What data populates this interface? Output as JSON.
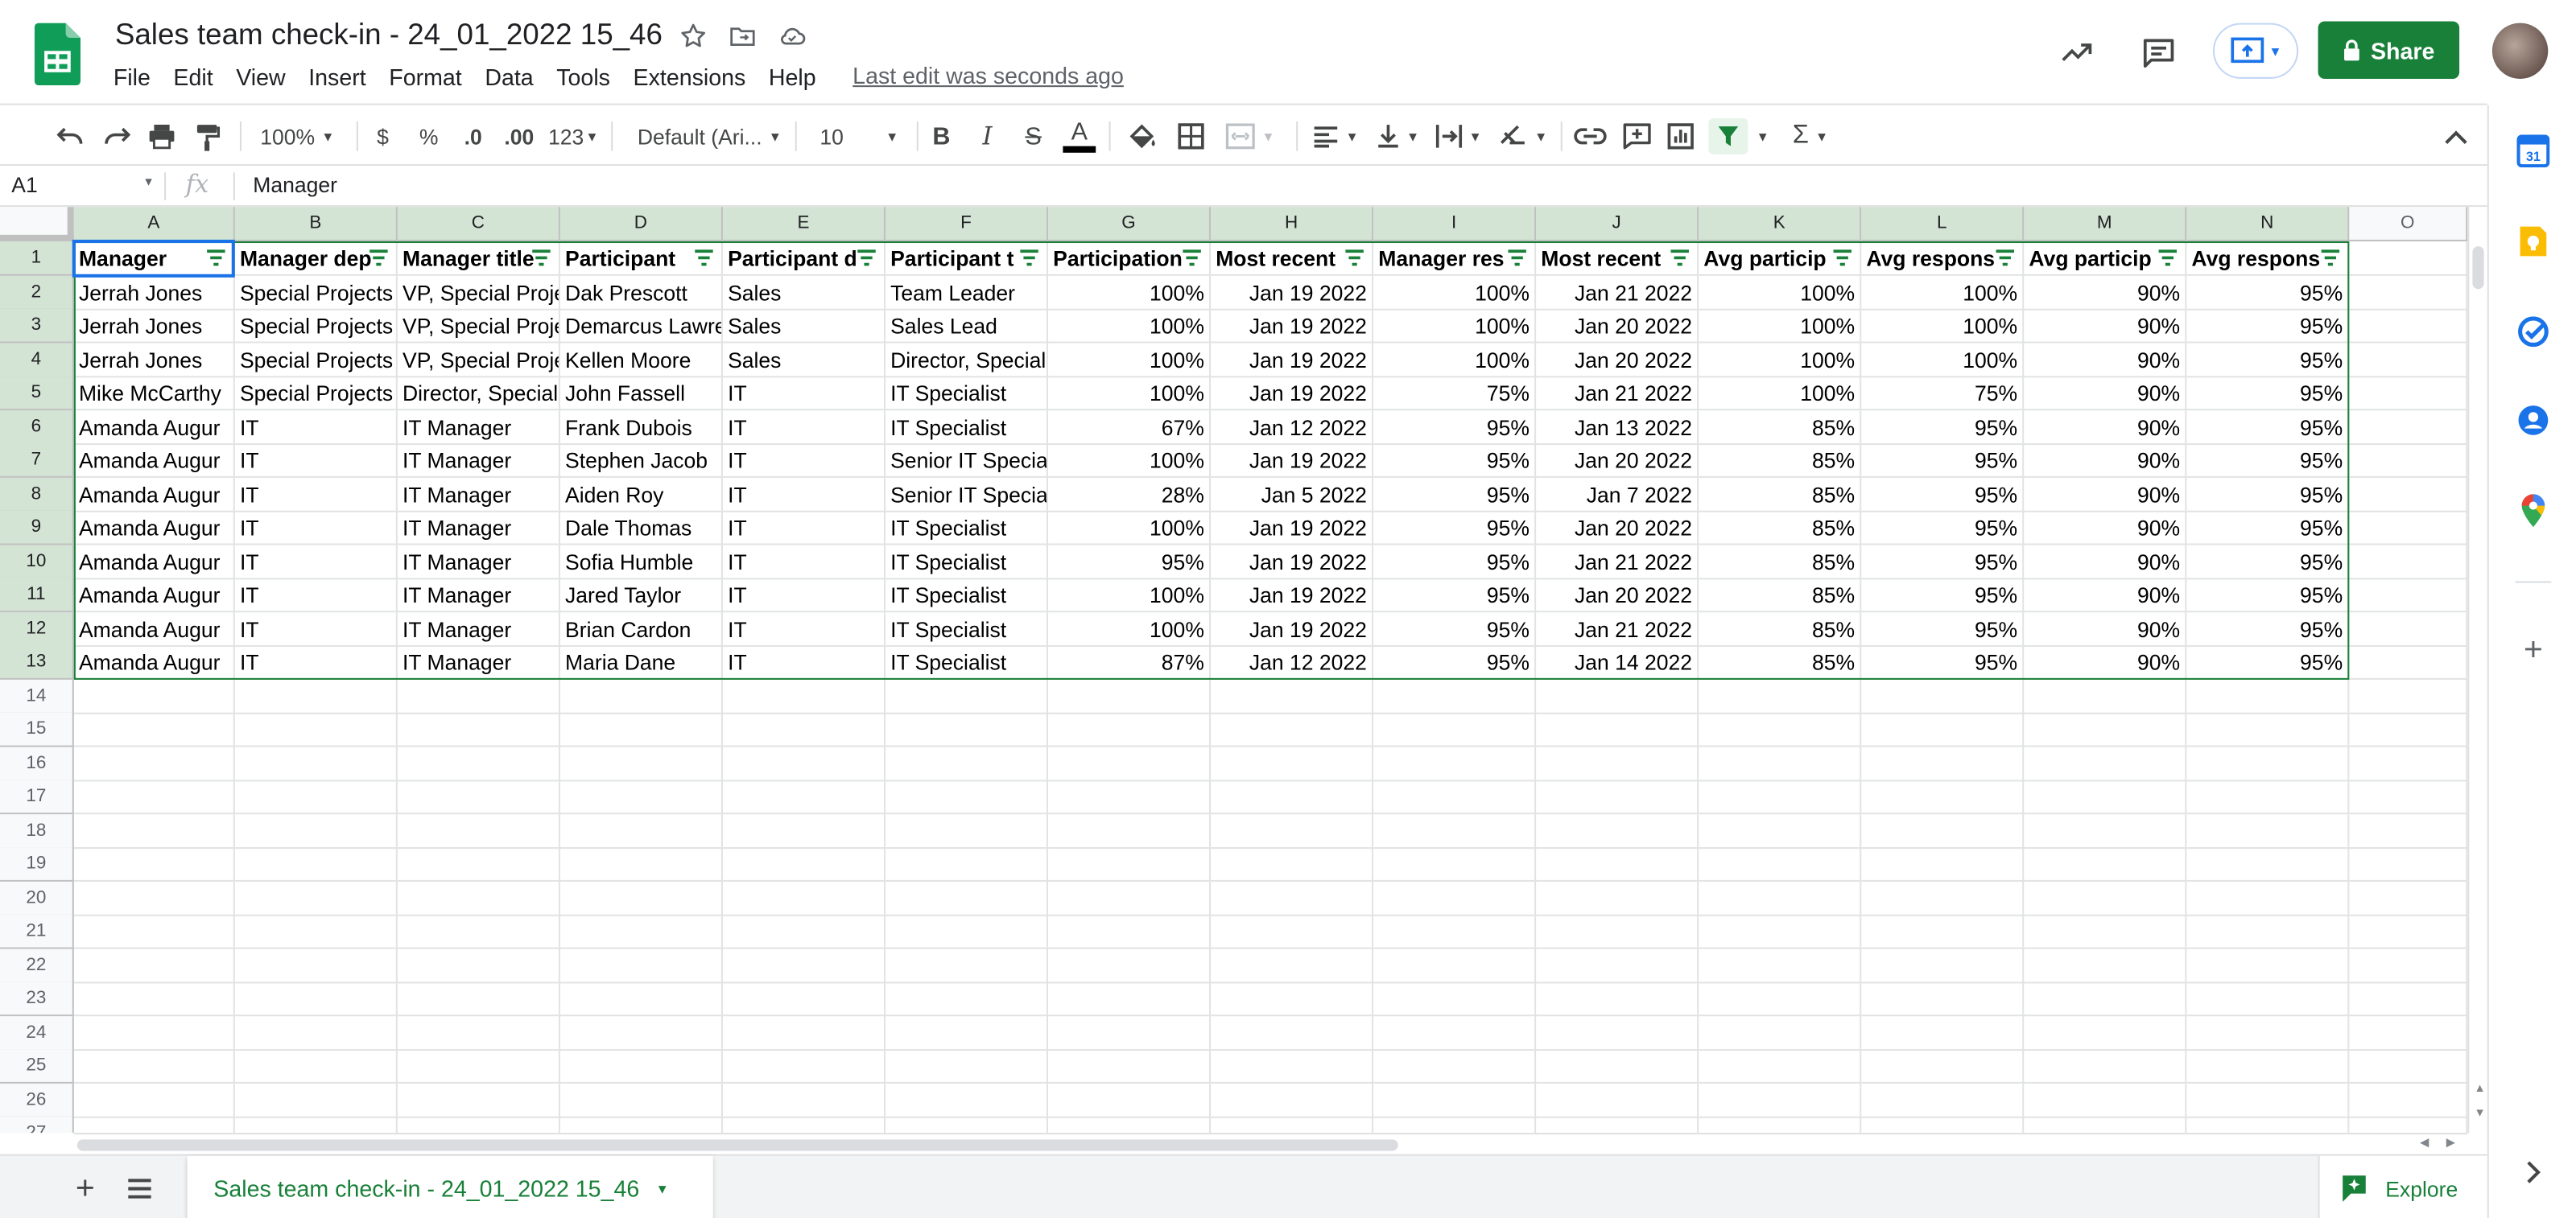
{
  "doc": {
    "title": "Sales team check-in - 24_01_2022 15_46",
    "last_edit": "Last edit was seconds ago"
  },
  "menu": [
    "File",
    "Edit",
    "View",
    "Insert",
    "Format",
    "Data",
    "Tools",
    "Extensions",
    "Help"
  ],
  "share_label": "Share",
  "toolbar": {
    "zoom": "100%",
    "currency": "$",
    "percent": "%",
    "dec_decrease": ".0",
    "dec_increase": ".00",
    "more_formats": "123",
    "font": "Default (Ari...",
    "font_size": "10",
    "bold": "B",
    "italic": "I",
    "strike": "S",
    "text_color": "A",
    "functions": "Σ"
  },
  "formula_bar": {
    "cell_ref": "A1",
    "fx": "fx",
    "value": "Manager"
  },
  "columns": [
    "A",
    "B",
    "C",
    "D",
    "E",
    "F",
    "G",
    "H",
    "I",
    "J",
    "K",
    "L",
    "M",
    "N",
    "O"
  ],
  "rows": [
    "1",
    "2",
    "3",
    "4",
    "5",
    "6",
    "7",
    "8",
    "9",
    "10",
    "11",
    "12",
    "13",
    "14",
    "15",
    "16",
    "17",
    "18",
    "19",
    "20",
    "21",
    "22",
    "23",
    "24",
    "25",
    "26",
    "27"
  ],
  "table": {
    "headers": [
      "Manager",
      "Manager dep",
      "Manager title",
      "Participant",
      "Participant d",
      "Participant t",
      "Participation",
      "Most recent",
      "Manager res",
      "Most recent",
      "Avg particip",
      "Avg respons",
      "Avg particip",
      "Avg respons"
    ],
    "rows": [
      [
        "Jerrah Jones",
        "Special Projects",
        "VP, Special Projects",
        "Dak Prescott",
        "Sales",
        "Team Leader",
        "100%",
        "Jan 19 2022",
        "100%",
        "Jan 21 2022",
        "100%",
        "100%",
        "90%",
        "95%"
      ],
      [
        "Jerrah Jones",
        "Special Projects",
        "VP, Special Projects",
        "Demarcus Lawrence",
        "Sales",
        "Sales Lead",
        "100%",
        "Jan 19 2022",
        "100%",
        "Jan 20 2022",
        "100%",
        "100%",
        "90%",
        "95%"
      ],
      [
        "Jerrah Jones",
        "Special Projects",
        "VP, Special Projects",
        "Kellen Moore",
        "Sales",
        "Director, Special",
        "100%",
        "Jan 19 2022",
        "100%",
        "Jan 20 2022",
        "100%",
        "100%",
        "90%",
        "95%"
      ],
      [
        "Mike McCarthy",
        "Special Projects",
        "Director, Special",
        "John Fassell",
        "IT",
        "IT Specialist",
        "100%",
        "Jan 19 2022",
        "75%",
        "Jan 21 2022",
        "100%",
        "75%",
        "90%",
        "95%"
      ],
      [
        "Amanda Augur",
        "IT",
        "IT Manager",
        "Frank Dubois",
        "IT",
        "IT Specialist",
        "67%",
        "Jan 12 2022",
        "95%",
        "Jan 13 2022",
        "85%",
        "95%",
        "90%",
        "95%"
      ],
      [
        "Amanda Augur",
        "IT",
        "IT Manager",
        "Stephen Jacob",
        "IT",
        "Senior IT Specialist",
        "100%",
        "Jan 19 2022",
        "95%",
        "Jan 20 2022",
        "85%",
        "95%",
        "90%",
        "95%"
      ],
      [
        "Amanda Augur",
        "IT",
        "IT Manager",
        "Aiden Roy",
        "IT",
        "Senior IT Specialist",
        "28%",
        "Jan 5 2022",
        "95%",
        "Jan 7 2022",
        "85%",
        "95%",
        "90%",
        "95%"
      ],
      [
        "Amanda Augur",
        "IT",
        "IT Manager",
        "Dale Thomas",
        "IT",
        "IT Specialist",
        "100%",
        "Jan 19 2022",
        "95%",
        "Jan 20 2022",
        "85%",
        "95%",
        "90%",
        "95%"
      ],
      [
        "Amanda Augur",
        "IT",
        "IT Manager",
        "Sofia Humble",
        "IT",
        "IT Specialist",
        "95%",
        "Jan 19 2022",
        "95%",
        "Jan 21 2022",
        "85%",
        "95%",
        "90%",
        "95%"
      ],
      [
        "Amanda Augur",
        "IT",
        "IT Manager",
        "Jared Taylor",
        "IT",
        "IT Specialist",
        "100%",
        "Jan 19 2022",
        "95%",
        "Jan 20 2022",
        "85%",
        "95%",
        "90%",
        "95%"
      ],
      [
        "Amanda Augur",
        "IT",
        "IT Manager",
        "Brian Cardon",
        "IT",
        "IT Specialist",
        "100%",
        "Jan 19 2022",
        "95%",
        "Jan 21 2022",
        "85%",
        "95%",
        "90%",
        "95%"
      ],
      [
        "Amanda Augur",
        "IT",
        "IT Manager",
        "Maria Dane",
        "IT",
        "IT Specialist",
        "87%",
        "Jan 12 2022",
        "95%",
        "Jan 14 2022",
        "85%",
        "95%",
        "90%",
        "95%"
      ]
    ]
  },
  "sheet_tab": "Sales team check-in - 24_01_2022 15_46",
  "explore_label": "Explore",
  "colors": {
    "brand_green": "#188038",
    "selection_blue": "#1a73e8",
    "header_selected": "#d3e3d4"
  }
}
